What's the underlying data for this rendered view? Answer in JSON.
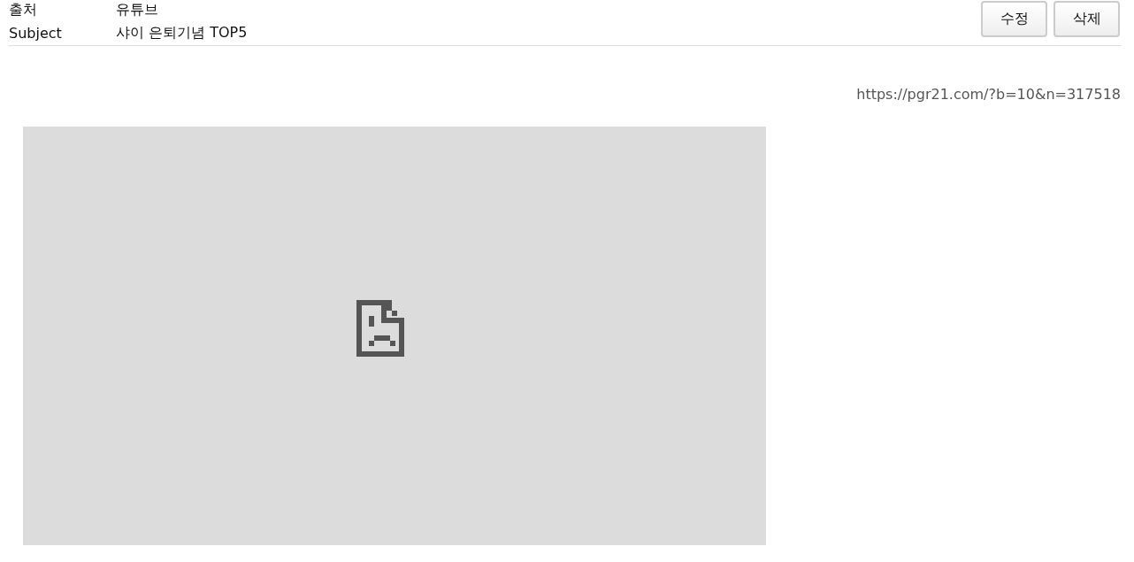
{
  "meta_rows": [
    {
      "label": "출처",
      "value": "유튜브"
    },
    {
      "label": "Subject",
      "value": "샤이 은퇴기념 TOP5"
    }
  ],
  "buttons": [
    {
      "label": "수정"
    },
    {
      "label": "삭제"
    }
  ],
  "source_url": "https://pgr21.com/?b=10&n=317518",
  "embed": {
    "kind": "error"
  }
}
